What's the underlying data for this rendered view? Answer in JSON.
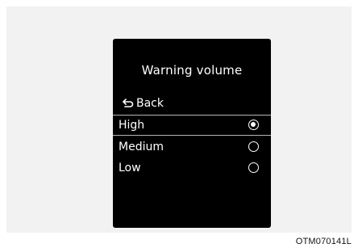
{
  "screen": {
    "title": "Warning volume",
    "back_label": "Back",
    "options": [
      {
        "label": "High",
        "selected": true
      },
      {
        "label": "Medium",
        "selected": false
      },
      {
        "label": "Low",
        "selected": false
      }
    ]
  },
  "figure_code": "OTM070141L",
  "icons": {
    "back": "back-arrow-icon",
    "radio_selected": "radio-selected-icon",
    "radio_empty": "radio-empty-icon"
  },
  "colors": {
    "screen_background": "#000000",
    "text": "#ffffff",
    "frame_background": "#f2f2f2",
    "divider": "#b5b5b5"
  }
}
